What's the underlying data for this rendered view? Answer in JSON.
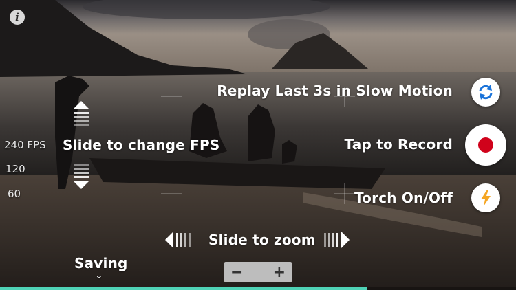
{
  "info": {
    "icon": "info-icon",
    "glyph": "i"
  },
  "fps": {
    "hint": "Slide to change FPS",
    "options": [
      "240 FPS",
      "120",
      "60"
    ],
    "selected": "240 FPS"
  },
  "zoom": {
    "hint": "Slide to zoom",
    "minus": "−",
    "plus": "+"
  },
  "actions": {
    "replay_label": "Replay Last 3s in Slow Motion",
    "record_label": "Tap to Record",
    "torch_label": "Torch On/Off"
  },
  "saving": {
    "label": "Saving",
    "chevron": "⌄"
  },
  "progress": {
    "fraction": 0.71
  },
  "colors": {
    "record": "#d0021b",
    "replay": "#1a73d9",
    "torch": "#f5a623",
    "progress": "#4fd3b6"
  }
}
